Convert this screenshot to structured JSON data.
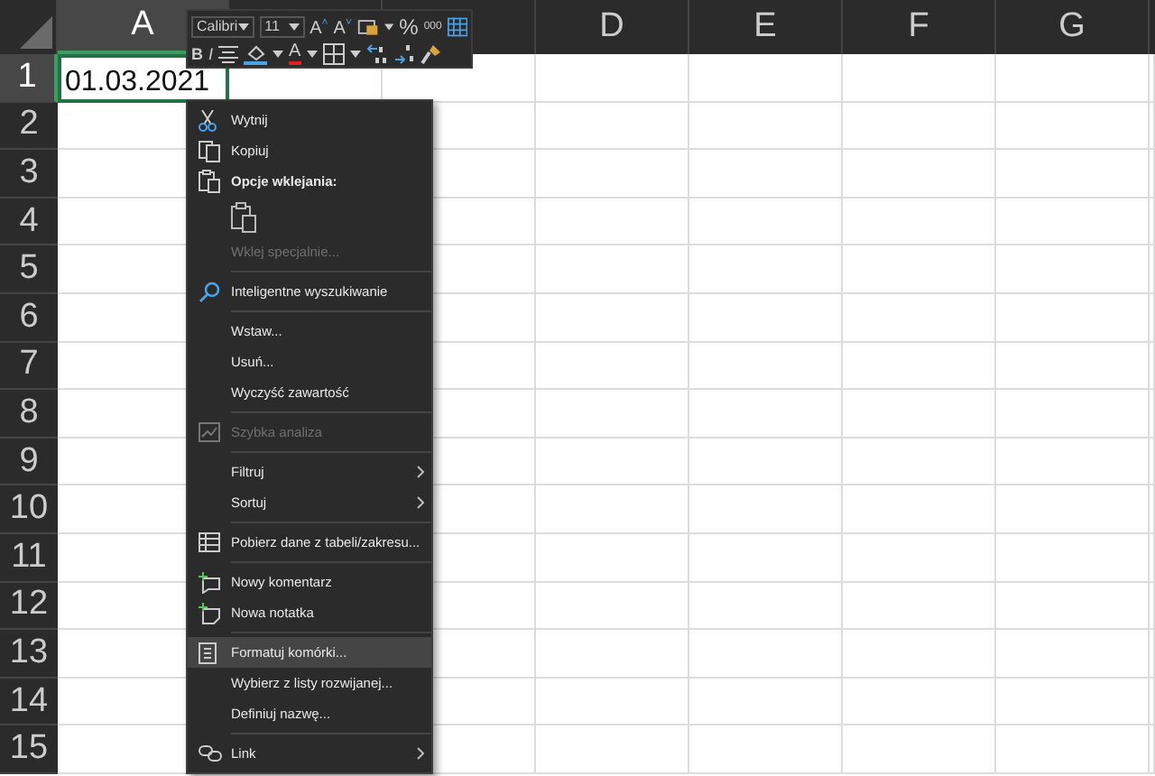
{
  "columns": [
    {
      "label": "A",
      "selected": true
    },
    {
      "selected": false
    },
    {
      "selected": false
    },
    {
      "label": "D",
      "selected": false
    },
    {
      "label": "E",
      "selected": false
    },
    {
      "label": "F",
      "selected": false
    },
    {
      "label": "G",
      "selected": false
    }
  ],
  "rows": [
    {
      "label": "1",
      "selected": true,
      "cells": [
        "01.03.2021"
      ]
    },
    {
      "label": "2",
      "selected": false
    },
    {
      "label": "3",
      "selected": false
    },
    {
      "label": "4",
      "selected": false
    },
    {
      "label": "5",
      "selected": false
    },
    {
      "label": "6",
      "selected": false
    },
    {
      "label": "7",
      "selected": false
    },
    {
      "label": "8",
      "selected": false
    },
    {
      "label": "9",
      "selected": false
    },
    {
      "label": "10",
      "selected": false
    },
    {
      "label": "11",
      "selected": false
    },
    {
      "label": "12",
      "selected": false
    },
    {
      "label": "13",
      "selected": false
    },
    {
      "label": "14",
      "selected": false
    },
    {
      "label": "15",
      "selected": false
    }
  ],
  "mini_toolbar": {
    "font": "Calibri",
    "size": "11",
    "bold": "B",
    "italic": "I",
    "grow": "A",
    "grow_arrow": "˄",
    "shrink": "A",
    "shrink_arrow": "˅",
    "font_color": "A",
    "percent": "%",
    "thousands": "000"
  },
  "context_menu": [
    {
      "kind": "item",
      "label": "Wytnij",
      "disabled": false,
      "submenu": false,
      "highlighted": false
    },
    {
      "kind": "item",
      "label": "Kopiuj",
      "disabled": false,
      "submenu": false,
      "highlighted": false
    },
    {
      "kind": "header",
      "label": "Opcje wklejania:"
    },
    {
      "kind": "paste-options"
    },
    {
      "kind": "item",
      "label": "Wklej specjalnie...",
      "disabled": true,
      "submenu": false,
      "highlighted": false
    },
    {
      "kind": "separator"
    },
    {
      "kind": "item",
      "label": "Inteligentne wyszukiwanie",
      "disabled": false,
      "submenu": false,
      "highlighted": false
    },
    {
      "kind": "separator"
    },
    {
      "kind": "item",
      "label": "Wstaw...",
      "disabled": false,
      "submenu": false,
      "highlighted": false
    },
    {
      "kind": "item",
      "label": "Usuń...",
      "disabled": false,
      "submenu": false,
      "highlighted": false
    },
    {
      "kind": "item",
      "label": "Wyczyść zawartość",
      "disabled": false,
      "submenu": false,
      "highlighted": false
    },
    {
      "kind": "separator"
    },
    {
      "kind": "item",
      "label": "Szybka analiza",
      "disabled": true,
      "submenu": false,
      "highlighted": false
    },
    {
      "kind": "separator"
    },
    {
      "kind": "item",
      "label": "Filtruj",
      "disabled": false,
      "submenu": true,
      "highlighted": false
    },
    {
      "kind": "item",
      "label": "Sortuj",
      "disabled": false,
      "submenu": true,
      "highlighted": false
    },
    {
      "kind": "separator"
    },
    {
      "kind": "item",
      "label": "Pobierz dane z tabeli/zakresu...",
      "disabled": false,
      "submenu": false,
      "highlighted": false
    },
    {
      "kind": "separator"
    },
    {
      "kind": "item",
      "label": "Nowy komentarz",
      "disabled": false,
      "submenu": false,
      "highlighted": false
    },
    {
      "kind": "item",
      "label": "Nowa notatka",
      "disabled": false,
      "submenu": false,
      "highlighted": false
    },
    {
      "kind": "separator"
    },
    {
      "kind": "item",
      "label": "Formatuj komórki...",
      "disabled": false,
      "submenu": false,
      "highlighted": true
    },
    {
      "kind": "item",
      "label": "Wybierz z listy rozwijanej...",
      "disabled": false,
      "submenu": false,
      "highlighted": false
    },
    {
      "kind": "item",
      "label": "Definiuj nazwę...",
      "disabled": false,
      "submenu": false,
      "highlighted": false
    },
    {
      "kind": "separator"
    },
    {
      "kind": "item",
      "label": "Link",
      "disabled": false,
      "submenu": true,
      "highlighted": false
    }
  ]
}
